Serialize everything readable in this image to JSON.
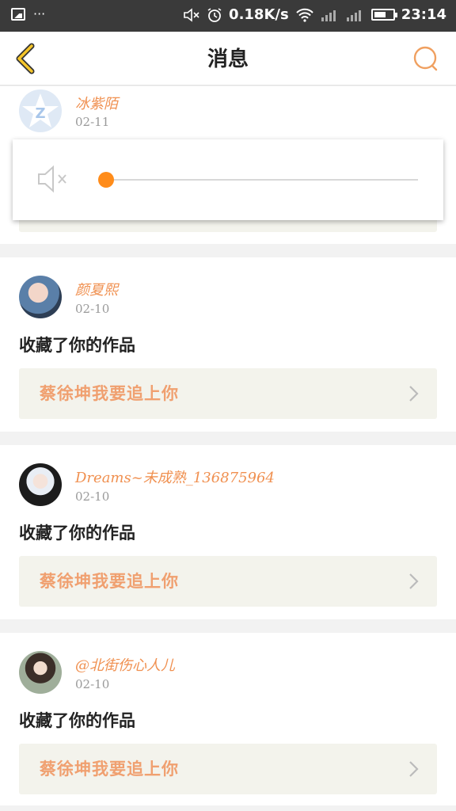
{
  "status_bar": {
    "left_icons": [
      "image-icon",
      "more-dots-icon"
    ],
    "dots": "···",
    "speed": "0.18K/s",
    "time": "23:14",
    "right_icons": [
      "mute-icon",
      "alarm-icon",
      "wifi-icon",
      "signal-1-icon",
      "signal-2-icon",
      "battery-icon"
    ]
  },
  "header": {
    "title": "消息",
    "back_icon": "chevron-left-icon",
    "search_icon": "search-icon",
    "accent": "#f5a623"
  },
  "messages": [
    {
      "username": "冰紫陌",
      "date": "02-11",
      "avatar": "default-avatar-icon"
    },
    {
      "username": "颜夏熙",
      "date": "02-10",
      "action": "收藏了你的作品",
      "work_title": "蔡徐坤我要追上你"
    },
    {
      "username": "Dreams~未成熟_136875964",
      "date": "02-10",
      "action": "收藏了你的作品",
      "work_title": "蔡徐坤我要追上你"
    },
    {
      "username": "@北街伤心人儿",
      "date": "02-10",
      "action": "收藏了你的作品",
      "work_title": "蔡徐坤我要追上你"
    }
  ],
  "volume_popup": {
    "icon": "speaker-muted-icon",
    "level": 0,
    "accent": "#ff8c1a"
  }
}
